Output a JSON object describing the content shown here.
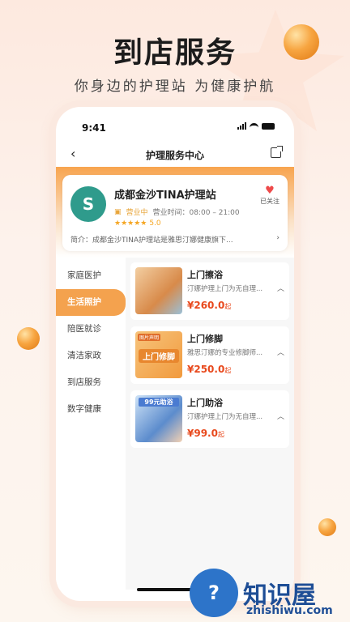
{
  "hero": {
    "title": "到店服务",
    "subtitle": "你身边的护理站 为健康护航"
  },
  "status_bar": {
    "time": "9:41"
  },
  "nav": {
    "back_icon": "chevron-left-icon",
    "title": "护理服务中心",
    "share_icon": "share-icon"
  },
  "store": {
    "name": "成都金沙TINA护理站",
    "status": "营业中",
    "hours": "营业时间：08:00 – 21:00",
    "stars": "★★★★★",
    "rating": "5.0",
    "follow_label": "已关注",
    "intro": "简介：成都金沙TINA护理站是雅思汀娜健康旗下...",
    "intro_arrow": "›"
  },
  "sidebar": {
    "items": [
      {
        "label": "家庭医护"
      },
      {
        "label": "生活照护",
        "active": true
      },
      {
        "label": "陪医就诊"
      },
      {
        "label": "清洁家政"
      },
      {
        "label": "到店服务"
      },
      {
        "label": "数字健康"
      }
    ]
  },
  "services": [
    {
      "title": "上门擦浴",
      "desc": "汀娜护理上门为无自理...",
      "price": "¥260.0",
      "unit": "起"
    },
    {
      "title": "上门修脚",
      "desc": "雅思汀娜的专业修脚师...",
      "price": "¥250.0",
      "unit": "起",
      "thumb_tag": "图片声明",
      "thumb_caption": "上门修脚"
    },
    {
      "title": "上门助浴",
      "desc": "汀娜护理上门为无自理...",
      "price": "¥99.0",
      "unit": "起",
      "thumb_caption": "99元助浴"
    }
  ],
  "watermark": {
    "text": "知识屋",
    "sub": "zhishiwu.com",
    "mark": "?"
  },
  "colors": {
    "accent": "#f4a24e",
    "price": "#e8491d",
    "brand_logo": "#2f9b8c"
  }
}
